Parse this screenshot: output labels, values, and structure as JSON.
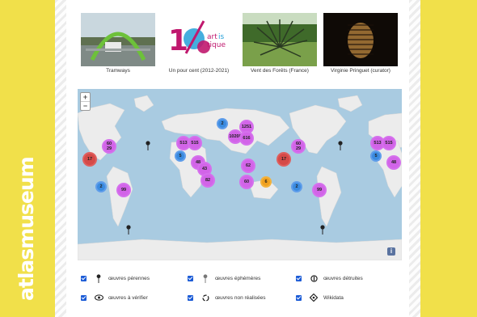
{
  "brand": "atlasmuseum",
  "gallery": [
    {
      "caption": "Tramways",
      "image": "tram-photo"
    },
    {
      "caption": "Un pour cent (2012-2021)",
      "image": "un-pour-cent-logo",
      "logo_number": "1%",
      "logo_word": "artistique"
    },
    {
      "caption": "Vent des Forêts (France)",
      "image": "spiky-sculpture-photo"
    },
    {
      "caption": "Virginie Pringuet (curator)",
      "image": "dark-portrait-photo"
    }
  ],
  "map": {
    "zoom_in": "+",
    "zoom_out": "−",
    "info": "i",
    "clusters": [
      {
        "label": "2",
        "color": "blue"
      },
      {
        "label": "1251",
        "color": "magenta"
      },
      {
        "label": "10208",
        "color": "magenta"
      },
      {
        "label": "616",
        "color": "magenta"
      },
      {
        "label": "60\n29",
        "color": "magenta"
      },
      {
        "label": "17",
        "color": "red"
      },
      {
        "label": "513",
        "color": "magenta"
      },
      {
        "label": "515",
        "color": "magenta"
      },
      {
        "label": "5",
        "color": "blue"
      },
      {
        "label": "48",
        "color": "magenta"
      },
      {
        "label": "43",
        "color": "magenta"
      },
      {
        "label": "82",
        "color": "magenta"
      },
      {
        "label": "62",
        "color": "magenta"
      },
      {
        "label": "60",
        "color": "magenta"
      },
      {
        "label": "6",
        "color": "orange"
      },
      {
        "label": "2",
        "color": "blue"
      },
      {
        "label": "99",
        "color": "magenta"
      },
      {
        "label": "60\n29",
        "color": "magenta"
      },
      {
        "label": "17",
        "color": "red"
      },
      {
        "label": "513",
        "color": "magenta"
      },
      {
        "label": "515",
        "color": "magenta"
      },
      {
        "label": "5",
        "color": "blue"
      },
      {
        "label": "48",
        "color": "magenta"
      },
      {
        "label": "2",
        "color": "blue"
      },
      {
        "label": "99",
        "color": "magenta"
      }
    ]
  },
  "legend": [
    {
      "label": "œuvres pérennes",
      "icon": "pin-icon",
      "checked": true
    },
    {
      "label": "œuvres éphémères",
      "icon": "grey-pin-icon",
      "checked": true
    },
    {
      "label": "œuvres détruites",
      "icon": "destroyed-icon",
      "checked": true
    },
    {
      "label": "œuvres à vérifier",
      "icon": "eye-icon",
      "checked": true
    },
    {
      "label": "œuvres non réalisées",
      "icon": "cycle-icon",
      "checked": true
    },
    {
      "label": "Wikidata",
      "icon": "wikidata-icon",
      "checked": true
    }
  ],
  "colors": {
    "page_background": "#f1e04a",
    "cluster_magenta": "#d264e8",
    "cluster_blue": "#3a8be0",
    "cluster_red": "#d54a48",
    "cluster_orange": "#f0a020",
    "checkbox": "#1b5bd6"
  }
}
